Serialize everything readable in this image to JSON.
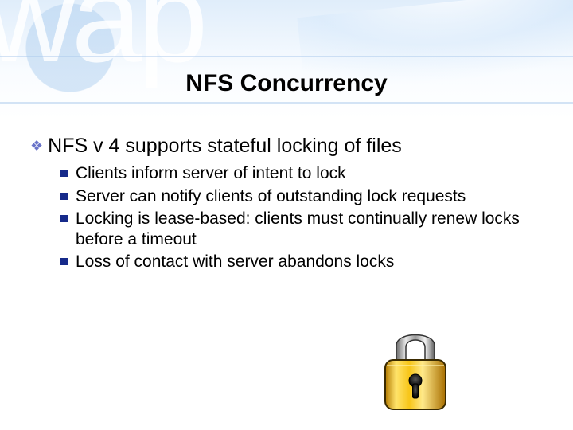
{
  "title": "NFS Concurrency",
  "watermark": "wap",
  "main_point": "NFS v 4 supports stateful locking of files",
  "sub_points": [
    "Clients inform server of intent to lock",
    "Server can notify clients of outstanding lock requests",
    "Locking is lease-based: clients must continually renew locks before a timeout",
    "Loss of contact with server abandons locks"
  ]
}
